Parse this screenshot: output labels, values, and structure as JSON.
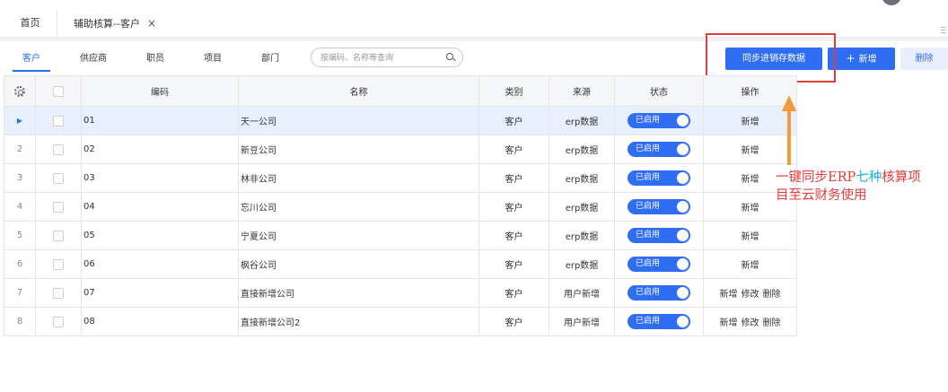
{
  "page_tabs": {
    "home_label": "首页",
    "active_label": "辅助核算--客户",
    "close_glyph": "×"
  },
  "sub_tabs": [
    {
      "label": "客户",
      "active": true
    },
    {
      "label": "供应商",
      "active": false
    },
    {
      "label": "职员",
      "active": false
    },
    {
      "label": "项目",
      "active": false
    },
    {
      "label": "部门",
      "active": false
    }
  ],
  "search": {
    "placeholder": "按编码、名称等查询",
    "value": ""
  },
  "toolbar": {
    "sync_label": "同步进销存数据",
    "add_label": "新增",
    "add_glyph": "+",
    "delete_label": "删除"
  },
  "table": {
    "columns": [
      "编码",
      "名称",
      "类别",
      "来源",
      "状态",
      "操作"
    ],
    "rows": [
      {
        "index": "▶",
        "code": "01",
        "name": "天一公司",
        "category": "客户",
        "source": "erp数据",
        "status": "已启用",
        "ops": [
          "新增"
        ],
        "selected": true
      },
      {
        "index": "2",
        "code": "02",
        "name": "新豆公司",
        "category": "客户",
        "source": "erp数据",
        "status": "已启用",
        "ops": [
          "新增"
        ],
        "selected": false
      },
      {
        "index": "3",
        "code": "03",
        "name": "林非公司",
        "category": "客户",
        "source": "erp数据",
        "status": "已启用",
        "ops": [
          "新增"
        ],
        "selected": false
      },
      {
        "index": "4",
        "code": "04",
        "name": "忘川公司",
        "category": "客户",
        "source": "erp数据",
        "status": "已启用",
        "ops": [
          "新增"
        ],
        "selected": false
      },
      {
        "index": "5",
        "code": "05",
        "name": "宁夏公司",
        "category": "客户",
        "source": "erp数据",
        "status": "已启用",
        "ops": [
          "新增"
        ],
        "selected": false
      },
      {
        "index": "6",
        "code": "06",
        "name": "枫谷公司",
        "category": "客户",
        "source": "erp数据",
        "status": "已启用",
        "ops": [
          "新增"
        ],
        "selected": false
      },
      {
        "index": "7",
        "code": "07",
        "name": "直接新增公司",
        "category": "客户",
        "source": "用户新增",
        "status": "已启用",
        "ops": [
          "新增",
          "修改",
          "删除"
        ],
        "selected": false
      },
      {
        "index": "8",
        "code": "08",
        "name": "直接新增公司2",
        "category": "客户",
        "source": "用户新增",
        "status": "已启用",
        "ops": [
          "新增",
          "修改",
          "删除"
        ],
        "selected": false
      }
    ]
  },
  "annotation": {
    "line1_part1": "一键同步ERP",
    "line1_highlight": "七种",
    "line1_part2": "核算项",
    "line2": "目至云财务使用"
  },
  "colors": {
    "primary": "#2f6df2",
    "annotation_red": "#e33a3a",
    "annotation_blue": "#1aaee0",
    "arrow_orange": "#f39a3c",
    "selected_row": "#e8f0fe"
  },
  "icons": {
    "settings": "gear-icon",
    "search": "search-icon",
    "close": "close-icon",
    "more": "more-icon"
  }
}
